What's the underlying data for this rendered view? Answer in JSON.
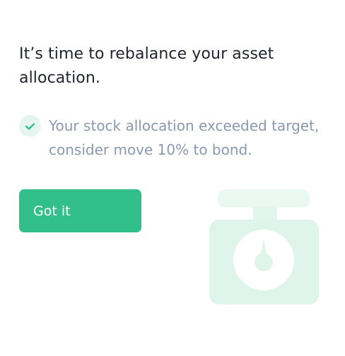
{
  "prompt": {
    "title": "It’s time to rebalance your asset allocation.",
    "message": "Your stock allocation exceeded target, consider move 10% to bond.",
    "status_icon": "check-icon",
    "illustration_icon": "weighing-scale-icon",
    "primary_button_label": "Got it"
  },
  "colors": {
    "accent": "#33bf8b",
    "title_text": "#1f2430",
    "body_text": "#8a99ad",
    "illustration": "#dff4eb"
  }
}
